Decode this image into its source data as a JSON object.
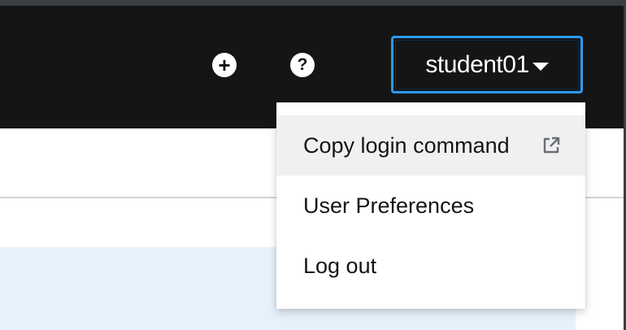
{
  "masthead": {
    "add_icon": "plus-circle-icon",
    "help_icon": "question-circle-icon",
    "user": {
      "name": "student01",
      "caret_icon": "caret-down-icon",
      "focus_border_color": "#2b9af3"
    }
  },
  "user_menu": {
    "items": [
      {
        "label": "Copy login command",
        "icon": "external-link-icon",
        "highlighted": true
      },
      {
        "label": "User Preferences"
      },
      {
        "label": "Log out"
      }
    ]
  },
  "colors": {
    "masthead_bg": "#151515",
    "panel_bg": "#e7f1fa",
    "menu_hover_bg": "#f0f0f0"
  }
}
